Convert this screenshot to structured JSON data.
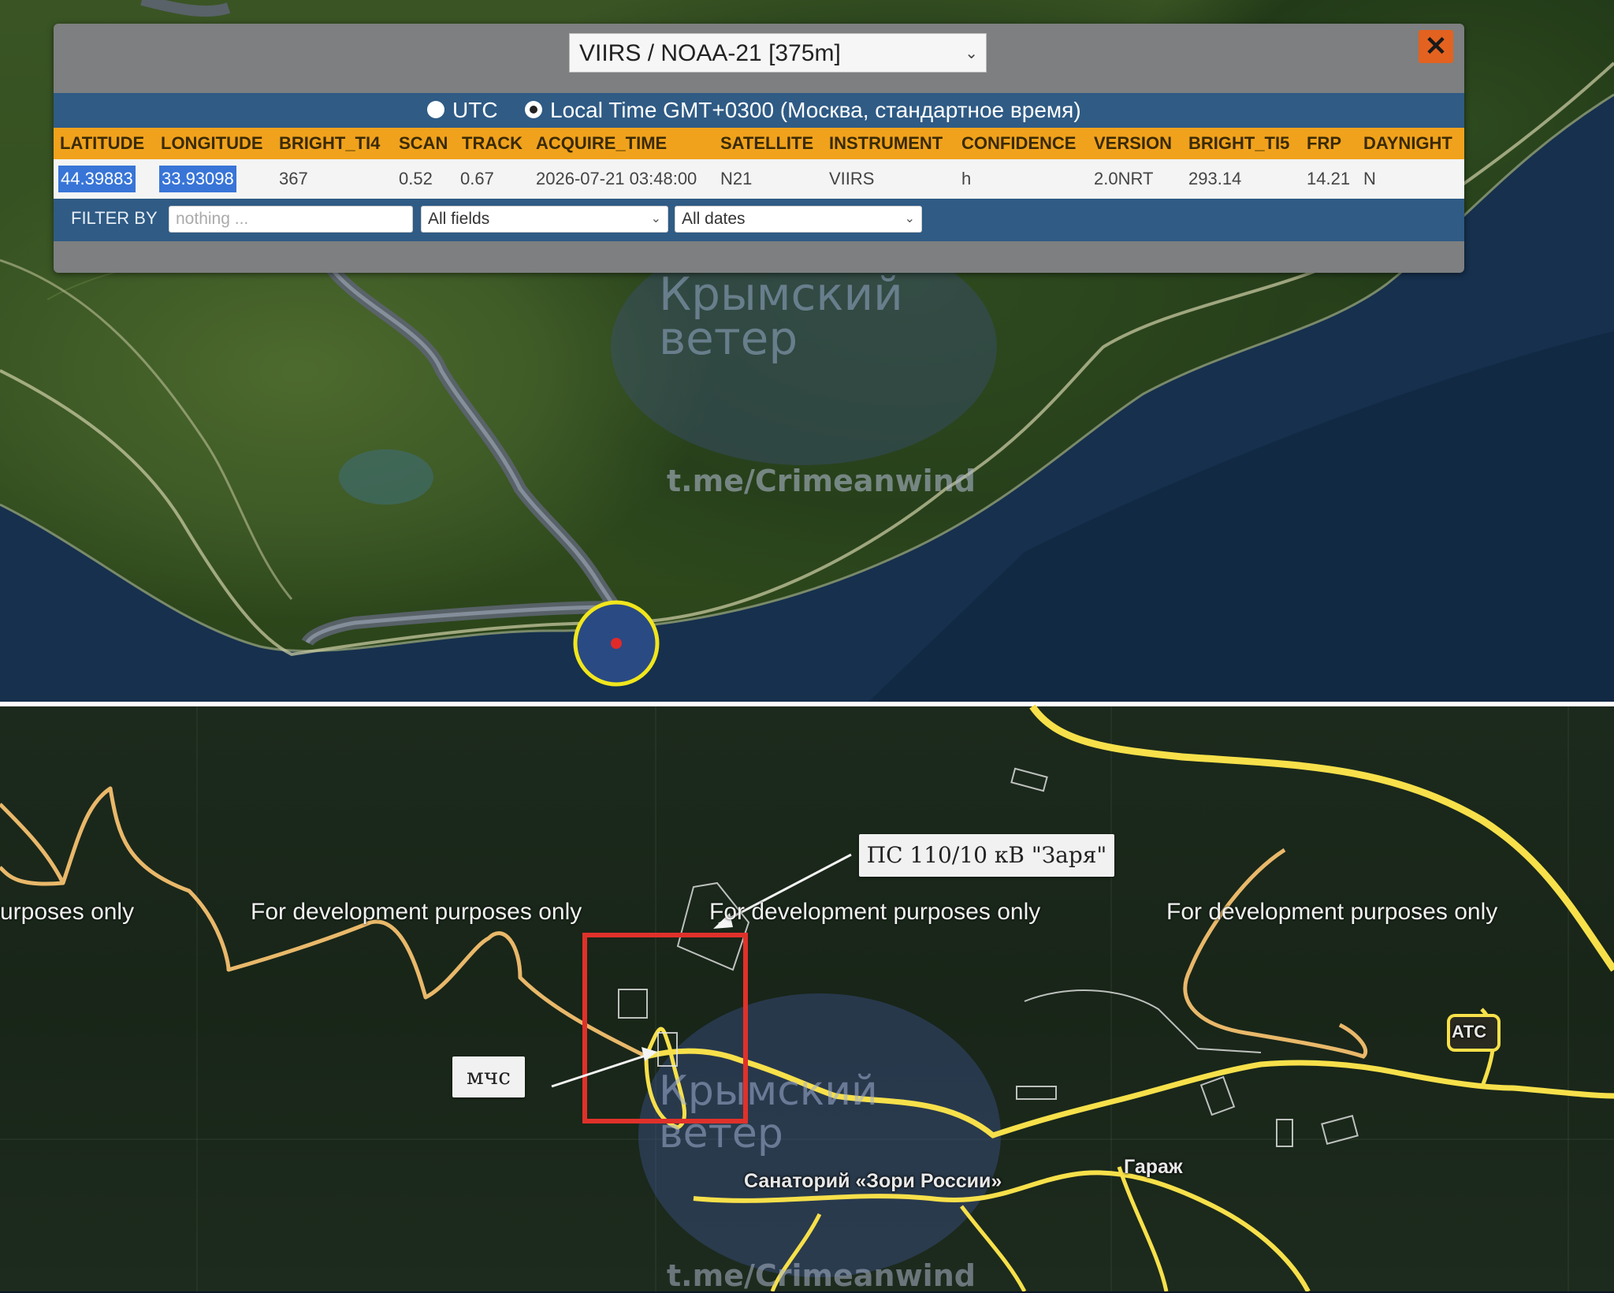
{
  "popup": {
    "source_select": "VIIRS / NOAA-21 [375m]",
    "close_label": "✕",
    "timezone": {
      "utc_label": "UTC",
      "local_label": "Local Time GMT+0300 (Москва, стандартное время)",
      "selected": "local"
    },
    "columns": [
      "LATITUDE",
      "LONGITUDE",
      "BRIGHT_TI4",
      "SCAN",
      "TRACK",
      "ACQUIRE_TIME",
      "SATELLITE",
      "INSTRUMENT",
      "CONFIDENCE",
      "VERSION",
      "BRIGHT_TI5",
      "FRP",
      "DAYNIGHT"
    ],
    "row": {
      "latitude": "44.39883",
      "longitude": "33.93098",
      "bright_ti4": "367",
      "scan": "0.52",
      "track": "0.67",
      "acquire_time": "2026-07-21 03:48:00",
      "satellite": "N21",
      "instrument": "VIIRS",
      "confidence": "h",
      "version": "2.0NRT",
      "bright_ti5": "293.14",
      "frp": "14.21",
      "daynight": "N"
    },
    "filter": {
      "label": "FILTER BY",
      "placeholder": "nothing ...",
      "field_select": "All fields",
      "date_select": "All dates"
    }
  },
  "watermark": {
    "line1": "Крымский",
    "line2": "ветер",
    "url": "t.me/Crimeanwind"
  },
  "bottom_map": {
    "dev_notice": "For development purposes only",
    "dev_notice_cut": "urposes only",
    "callout_substation": "ПС 110/10 кВ \"Заря\"",
    "callout_mchs": "мчс",
    "label_sanatorium": "Санаторий «Зори России»",
    "label_garage": "Гараж",
    "label_ats": "АТС"
  },
  "colors": {
    "fire_marker": "#f1e61c",
    "highlight_box": "#e0312a",
    "road_primary": "#f7e04a",
    "road_secondary": "#e9b86a",
    "header_orange": "#f0a21c",
    "bar_blue": "#2f5b85"
  }
}
